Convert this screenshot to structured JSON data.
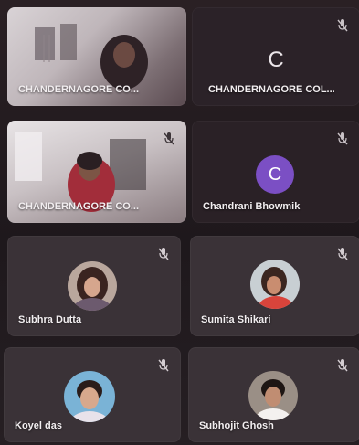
{
  "tiles": [
    {
      "name": "CHANDERNAGORE CO..."
    },
    {
      "name": "CHANDERNAGORE COL...",
      "initial": "C"
    },
    {
      "name": "CHANDERNAGORE CO..."
    },
    {
      "name": "Chandrani Bhowmik",
      "initial": "C"
    },
    {
      "name": "Subhra Dutta"
    },
    {
      "name": "Sumita Shikari"
    },
    {
      "name": "Koyel das"
    },
    {
      "name": "Subhojit Ghosh"
    }
  ],
  "colors": {
    "avatar_purple": "#7b4fc4",
    "tile_bg": "#3b3338"
  },
  "icons": {
    "mic": "mic-off-icon"
  }
}
